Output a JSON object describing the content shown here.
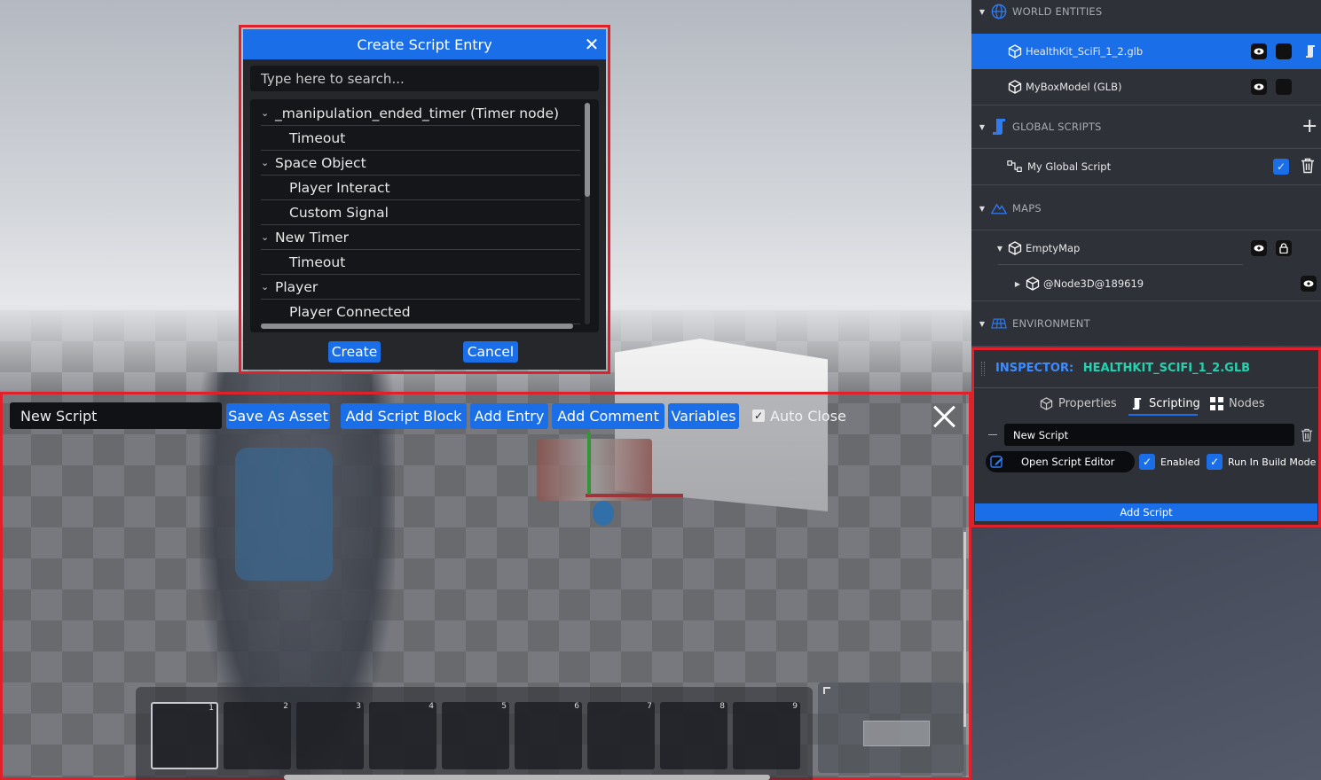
{
  "dialog": {
    "title": "Create Script Entry",
    "search_placeholder": "Type here to search...",
    "entries": [
      {
        "label": "_manipulation_ended_timer (Timer node)",
        "type": "group"
      },
      {
        "label": "Timeout",
        "type": "child"
      },
      {
        "label": "Space Object",
        "type": "group"
      },
      {
        "label": "Player Interact",
        "type": "child"
      },
      {
        "label": "Custom Signal",
        "type": "child"
      },
      {
        "label": "New Timer",
        "type": "group"
      },
      {
        "label": "Timeout",
        "type": "child"
      },
      {
        "label": "Player",
        "type": "group"
      },
      {
        "label": "Player Connected",
        "type": "child"
      }
    ],
    "create_label": "Create",
    "cancel_label": "Cancel",
    "close_glyph": "✕"
  },
  "editor": {
    "script_name": "New Script",
    "save_as_asset": "Save As Asset",
    "add_script_block": "Add Script Block",
    "add_entry": "Add Entry",
    "add_comment": "Add Comment",
    "variables": "Variables",
    "auto_close": "Auto Close",
    "auto_close_checked": true
  },
  "hotbar": {
    "slots": [
      "1",
      "2",
      "3",
      "4",
      "5",
      "6",
      "7",
      "8",
      "9"
    ],
    "active_slot": "1"
  },
  "tree": {
    "world_entities": "WORLD ENTITIES",
    "entity_1": "HealthKit_SciFi_1_2.glb",
    "entity_2": "MyBoxModel (GLB)",
    "global_scripts": "GLOBAL SCRIPTS",
    "global_script_1": "My Global Script",
    "maps": "MAPS",
    "map_1": "EmptyMap",
    "map_child": "@Node3D@189619",
    "environment": "ENVIRONMENT"
  },
  "inspector": {
    "label": "INSPECTOR:",
    "target": "HEALTHKIT_SCIFI_1_2.GLB",
    "tabs": [
      "Properties",
      "Scripting",
      "Nodes"
    ],
    "active_tab": "Scripting",
    "script_name": "New Script",
    "open_editor": "Open Script Editor",
    "enabled": "Enabled",
    "run_in_build": "Run In Build Mode",
    "add_script": "Add Script"
  },
  "colors": {
    "accent": "#1a6fe8",
    "highlight_outline": "#e0202a",
    "inspector_label": "#3b8cff",
    "inspector_target": "#23d3b0"
  }
}
